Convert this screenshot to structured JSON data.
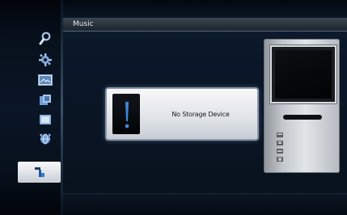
{
  "app": {
    "section_title": "Music"
  },
  "sidebar": {
    "items": [
      {
        "name": "search",
        "icon": "magnifier-icon"
      },
      {
        "name": "settings",
        "icon": "gear-icon"
      },
      {
        "name": "photo",
        "icon": "picture-icon"
      },
      {
        "name": "video",
        "icon": "film-icon"
      },
      {
        "name": "files",
        "icon": "folder-icon"
      },
      {
        "name": "network",
        "icon": "globe-icon"
      },
      {
        "name": "music",
        "icon": "music-icon",
        "selected": true
      }
    ]
  },
  "dialog": {
    "message": "No Storage Device",
    "icon": "exclamation-icon"
  },
  "device": {
    "icon": "media-player-device-icon"
  },
  "colors": {
    "background": "#0a1422",
    "dialog": "#e8ebee",
    "highlight": "#f4f6f8",
    "icon_blue": "#6f9fd8"
  }
}
